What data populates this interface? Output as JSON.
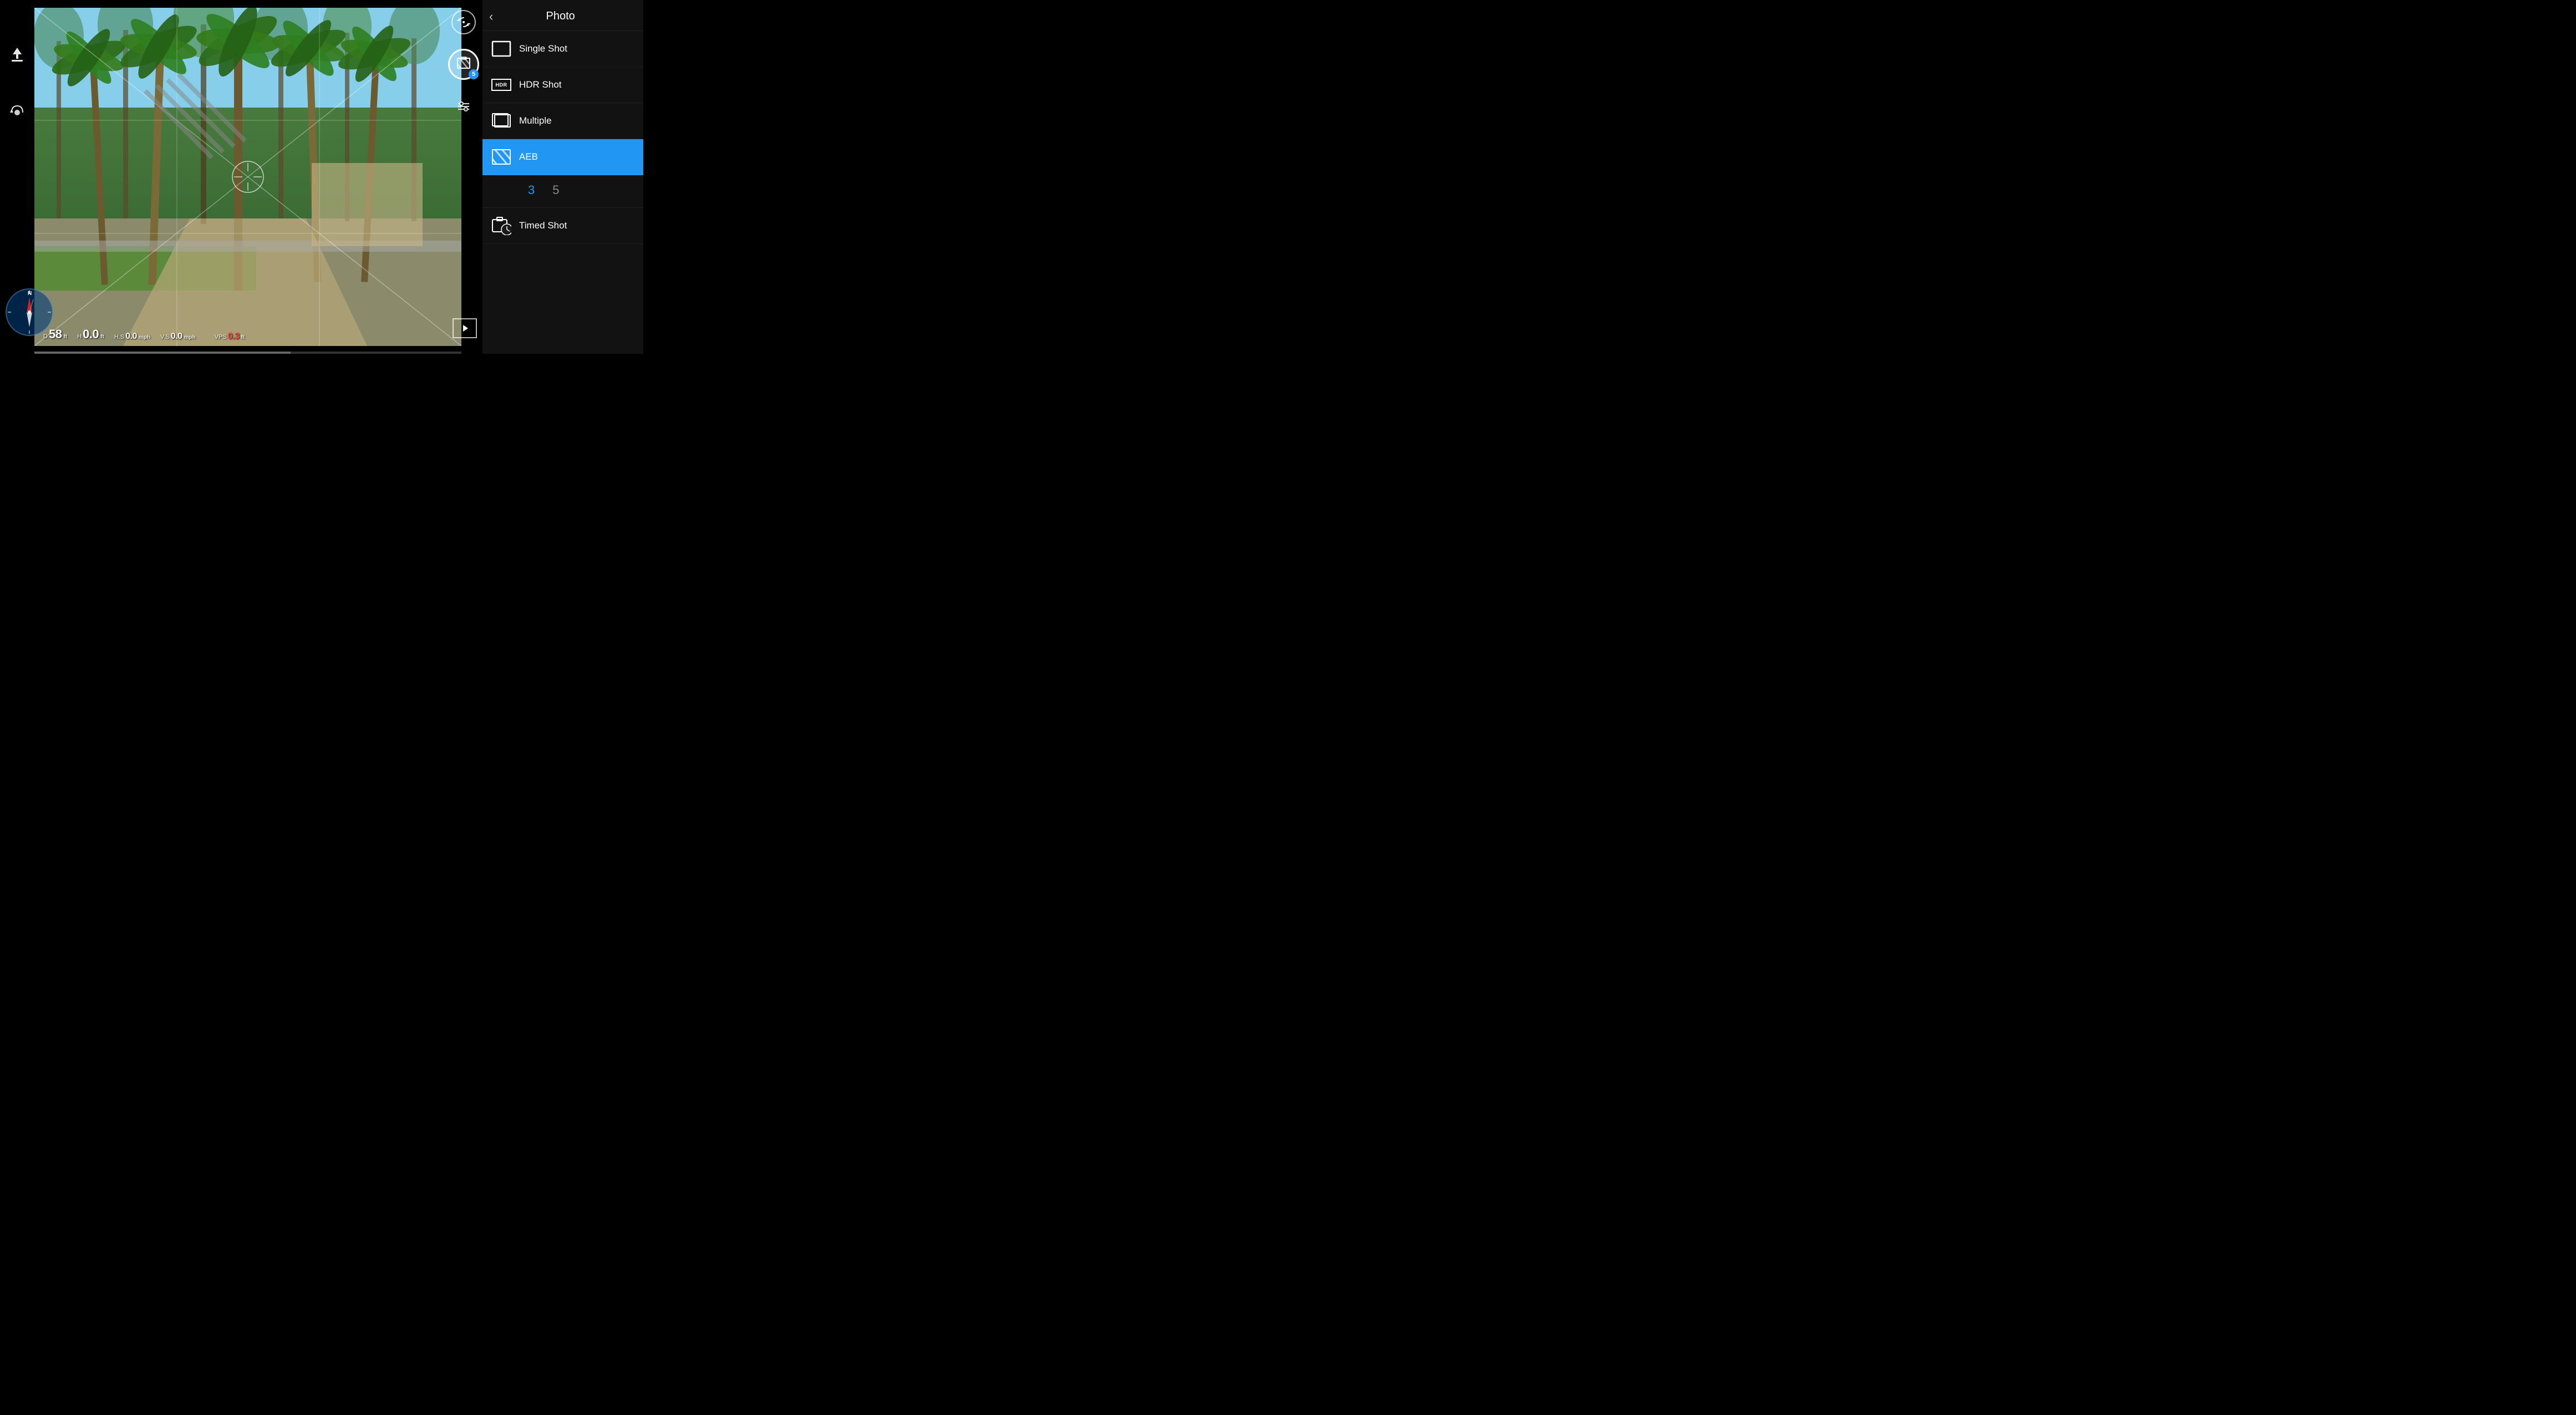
{
  "header": {
    "title": "Photo",
    "back_label": "‹"
  },
  "menu": {
    "items": [
      {
        "id": "single-shot",
        "label": "Single Shot",
        "active": false
      },
      {
        "id": "hdr-shot",
        "label": "HDR Shot",
        "active": false
      },
      {
        "id": "multiple",
        "label": "Multiple",
        "active": false
      },
      {
        "id": "aeb",
        "label": "AEB",
        "active": true
      },
      {
        "id": "timed-shot",
        "label": "Timed Shot",
        "active": false
      }
    ],
    "aeb_options": [
      {
        "value": "3",
        "selected": true
      },
      {
        "value": "5",
        "selected": false
      }
    ]
  },
  "hud": {
    "distance_label": "D",
    "distance_value": "58",
    "distance_unit": "ft",
    "horizontal_speed_label": "H.S",
    "horizontal_speed_value": "0.0",
    "horizontal_speed_unit": "mph",
    "altitude_label": "H",
    "altitude_value": "0.0",
    "altitude_unit": "ft",
    "vertical_speed_label": "V.S",
    "vertical_speed_value": "0.0",
    "vertical_speed_unit": "mph",
    "vps_label": "VPS",
    "vps_value": "0.3",
    "vps_unit": "ft"
  },
  "shutter_badge": "5",
  "icons": {
    "back": "‹",
    "upload": "⬆",
    "orbit": "↻",
    "camera_flip": "⟳",
    "settings": "⚙",
    "playback": "▶",
    "compass_n": "N"
  }
}
